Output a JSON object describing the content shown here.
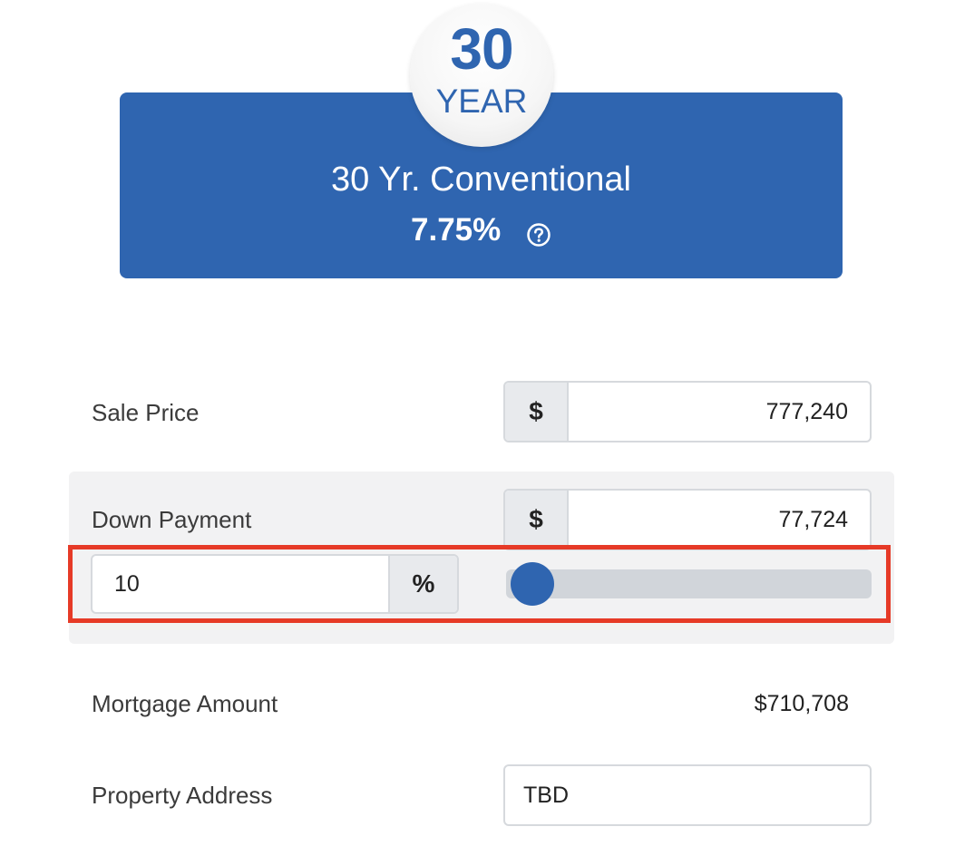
{
  "loan_card": {
    "term_number": "30",
    "term_unit": "YEAR",
    "name": "30 Yr. Conventional",
    "rate": "7.75%",
    "help_icon": "question-circle-icon",
    "accent_color": "#2f65b0"
  },
  "sale_price": {
    "label": "Sale Price",
    "currency_symbol": "$",
    "value": "777,240"
  },
  "down_payment": {
    "label": "Down Payment",
    "currency_symbol": "$",
    "amount": "77,724",
    "percent_value": "10",
    "percent_symbol": "%",
    "slider_fraction": 0.05
  },
  "mortgage_amount": {
    "label": "Mortgage Amount",
    "value": "$710,708"
  },
  "property_address": {
    "label": "Property Address",
    "value": "TBD"
  },
  "highlight_color": "#e63a27"
}
